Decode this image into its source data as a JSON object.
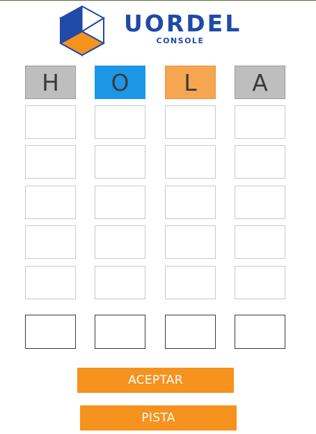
{
  "brand": {
    "title": "UORDEL",
    "subtitle": "CONSOLE"
  },
  "colors": {
    "grey": "#bfbebf",
    "blue": "#1c97e6",
    "orange": "#f6a651",
    "brand_blue": "#1f4aa8",
    "button": "#f6921e"
  },
  "board": {
    "rows": [
      [
        {
          "letter": "H",
          "state": "grey"
        },
        {
          "letter": "O",
          "state": "blue"
        },
        {
          "letter": "L",
          "state": "orange"
        },
        {
          "letter": "A",
          "state": "grey"
        }
      ],
      [
        {
          "letter": "",
          "state": "empty"
        },
        {
          "letter": "",
          "state": "empty"
        },
        {
          "letter": "",
          "state": "empty"
        },
        {
          "letter": "",
          "state": "empty"
        }
      ],
      [
        {
          "letter": "",
          "state": "empty"
        },
        {
          "letter": "",
          "state": "empty"
        },
        {
          "letter": "",
          "state": "empty"
        },
        {
          "letter": "",
          "state": "empty"
        }
      ],
      [
        {
          "letter": "",
          "state": "empty"
        },
        {
          "letter": "",
          "state": "empty"
        },
        {
          "letter": "",
          "state": "empty"
        },
        {
          "letter": "",
          "state": "empty"
        }
      ],
      [
        {
          "letter": "",
          "state": "empty"
        },
        {
          "letter": "",
          "state": "empty"
        },
        {
          "letter": "",
          "state": "empty"
        },
        {
          "letter": "",
          "state": "empty"
        }
      ],
      [
        {
          "letter": "",
          "state": "empty"
        },
        {
          "letter": "",
          "state": "empty"
        },
        {
          "letter": "",
          "state": "empty"
        },
        {
          "letter": "",
          "state": "empty"
        }
      ]
    ],
    "inputs": [
      "",
      "",
      "",
      ""
    ]
  },
  "buttons": {
    "accept_label": "ACEPTAR",
    "hint_label": "PISTA"
  }
}
